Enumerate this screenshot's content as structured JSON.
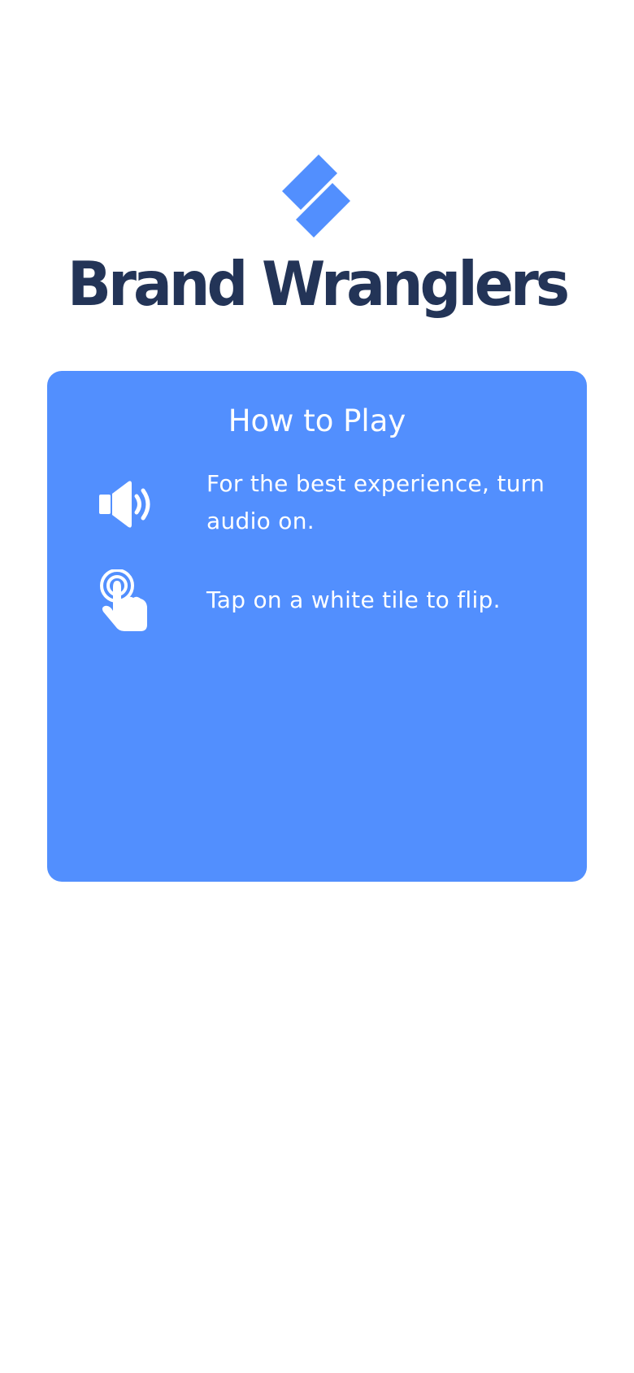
{
  "brand": {
    "title": "Brand Wranglers",
    "logo_icon": "stacked-diamonds-logo",
    "title_color": "#233457",
    "logo_color": "#528ffe"
  },
  "card": {
    "background": "#528ffe",
    "title": "How to Play",
    "rows": [
      {
        "icon": "speaker-icon",
        "text": "For the best experience, turn audio on."
      },
      {
        "icon": "tap-finger-icon",
        "text": "Tap on a white tile to flip."
      }
    ]
  }
}
